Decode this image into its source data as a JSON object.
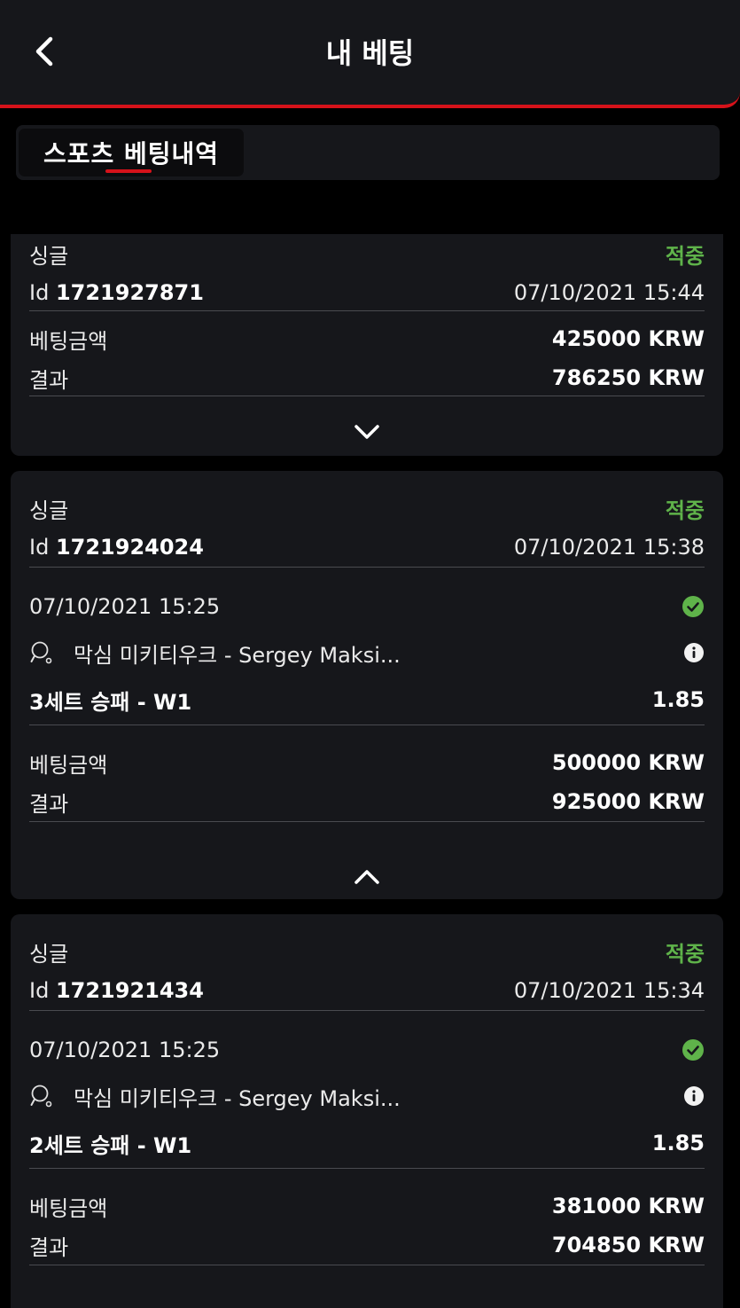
{
  "header": {
    "title": "내 베팅"
  },
  "tabs": [
    {
      "label": "스포츠 베팅내역"
    }
  ],
  "bets": [
    {
      "type": "싱글",
      "status": "적중",
      "id_prefix": "Id",
      "id": "1721927871",
      "datetime": "07/10/2021 15:44",
      "stake_label": "베팅금액",
      "stake": "425000 KRW",
      "result_label": "결과",
      "result": "786250 KRW",
      "expanded": false
    },
    {
      "type": "싱글",
      "status": "적중",
      "id_prefix": "Id",
      "id": "1721924024",
      "datetime": "07/10/2021 15:38",
      "event_datetime": "07/10/2021 15:25",
      "event_name": "막심 미키티우크 - Sergey Maksi...",
      "market": "3세트 승패 - W1",
      "odds": "1.85",
      "stake_label": "베팅금액",
      "stake": "500000 KRW",
      "result_label": "결과",
      "result": "925000 KRW",
      "expanded": true
    },
    {
      "type": "싱글",
      "status": "적중",
      "id_prefix": "Id",
      "id": "1721921434",
      "datetime": "07/10/2021 15:34",
      "event_datetime": "07/10/2021 15:25",
      "event_name": "막심 미키티우크 - Sergey Maksi...",
      "market": "2세트 승패 - W1",
      "odds": "1.85",
      "stake_label": "베팅금액",
      "stake": "381000 KRW",
      "result_label": "결과",
      "result": "704850 KRW",
      "expanded": true
    }
  ],
  "colors": {
    "accent": "#d6121a",
    "win": "#5fb34a",
    "card": "#16171b",
    "background": "#000000"
  },
  "icons": {
    "back": "chevron-left-icon",
    "sport": "table-tennis-icon",
    "check": "check-circle-icon",
    "info": "info-icon"
  }
}
